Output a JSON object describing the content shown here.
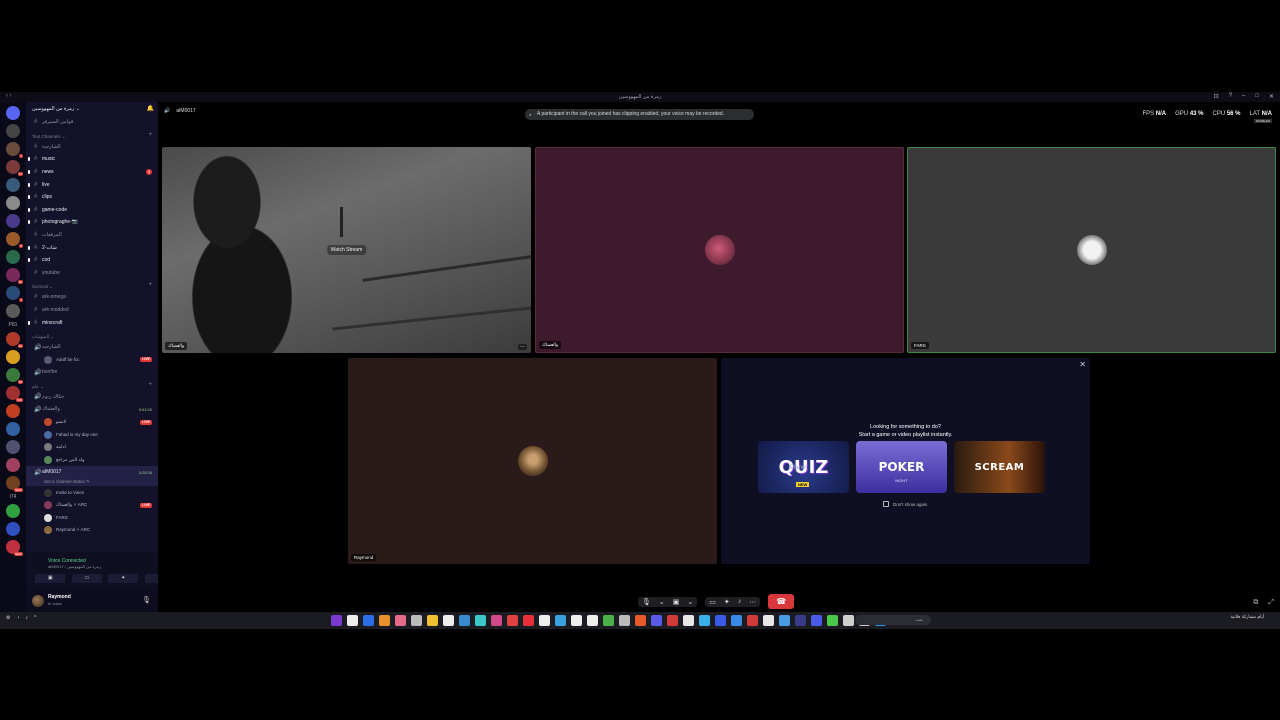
{
  "titlebar": {
    "title": "زمرة من المهووسين"
  },
  "rail": {
    "count_label": "P81",
    "count_label_2": "I74",
    "servers": [
      {
        "color": "#5865f2",
        "badge": ""
      },
      {
        "color": "#444",
        "badge": ""
      },
      {
        "color": "#6a4a3a",
        "badge": "3"
      },
      {
        "color": "#7a3a3a",
        "badge": "27"
      },
      {
        "color": "#3a5a7a",
        "badge": ""
      },
      {
        "color": "#8a8a8a",
        "badge": ""
      },
      {
        "color": "#4a3a8a",
        "badge": ""
      },
      {
        "color": "#9a5a2a",
        "badge": "5"
      },
      {
        "color": "#2a6a4a",
        "badge": ""
      },
      {
        "color": "#7a2a5a",
        "badge": "99"
      },
      {
        "color": "#2a4a7a",
        "badge": "3"
      },
      {
        "color": "#5a5a5a",
        "badge": ""
      }
    ],
    "servers_2": [
      {
        "color": "#b03a2a",
        "badge": "34"
      },
      {
        "color": "#d9a020",
        "badge": ""
      },
      {
        "color": "#3a7a3a",
        "badge": "99"
      },
      {
        "color": "#a03030",
        "badge": "100"
      },
      {
        "color": "#c04020",
        "badge": ""
      },
      {
        "color": "#3060a0",
        "badge": ""
      },
      {
        "color": "#505070",
        "badge": ""
      },
      {
        "color": "#a04060",
        "badge": ""
      },
      {
        "color": "#704020",
        "badge": "NEW"
      }
    ],
    "servers_3": [
      {
        "color": "#30a040",
        "badge": ""
      },
      {
        "color": "#3050c0",
        "badge": ""
      },
      {
        "color": "#c03040",
        "badge": "NEW"
      }
    ]
  },
  "sidebar": {
    "server_name": "زمرة من المهووسين",
    "top_channel": "قوانين السيرفر",
    "text_category": "Text Channels",
    "text_channels": [
      {
        "name": "الشارجية",
        "bright": false,
        "count": ""
      },
      {
        "name": "music",
        "bright": true,
        "count": ""
      },
      {
        "name": "news",
        "bright": true,
        "count": "3"
      },
      {
        "name": "live",
        "bright": true,
        "count": ""
      },
      {
        "name": "clips",
        "bright": true,
        "count": ""
      },
      {
        "name": "game-code",
        "bright": true,
        "count": ""
      },
      {
        "name": "photograghe-📷",
        "bright": true,
        "count": ""
      },
      {
        "name": "المرفقات",
        "bright": false,
        "count": ""
      },
      {
        "name": "شات-2",
        "bright": true,
        "count": ""
      },
      {
        "name": "cod",
        "bright": true,
        "count": ""
      },
      {
        "name": "youtube",
        "bright": false,
        "count": ""
      }
    ],
    "survival_category": "Survival",
    "survival_channels": [
      {
        "name": "ark-omega",
        "bright": false
      },
      {
        "name": "ark-modded",
        "bright": false
      },
      {
        "name": "minecraft",
        "bright": true
      }
    ],
    "voice_category": "الصوتيات",
    "voice_channel_1": "الشارجيه",
    "voice_1_user": "Adolf be fcc",
    "voice_1_live": "LIVE",
    "bonfire": "bonfire",
    "cat3": "عام",
    "voice_channel_2": "حكاك ريوم",
    "voice_channel_3": "والعشاك",
    "voice_3_timer": "9:01:00",
    "voice_3_users": [
      {
        "name": "لانسو",
        "live": "LIVE",
        "color": "#c04a2a"
      },
      {
        "name": "Fahad is my day one",
        "live": "",
        "color": "#4a6aa0"
      },
      {
        "name": "ادليته",
        "live": "",
        "color": "#7a7a7a"
      },
      {
        "name": "ولد المن مراجع",
        "live": "",
        "color": "#5a8a5a"
      }
    ],
    "active_channel": "aIM0017",
    "active_timer": "3:25:34",
    "active_status": "Set a channel status ✎",
    "invite": "Invite to Voice",
    "active_users": [
      {
        "name": "والعشاك ⚡ ARC",
        "live": "LIVE",
        "color": "#8a3a5a"
      },
      {
        "name": "FARS",
        "live": "",
        "color": "#dddddd"
      },
      {
        "name": "Raymond ⚡ ARC",
        "live": "",
        "color": "#8a6a3a"
      }
    ]
  },
  "voice": {
    "status": "Voice Connected",
    "channel": "aIM0017 / زمرة من المهووسين"
  },
  "user": {
    "name": "Raymond",
    "status": "In voice"
  },
  "stage": {
    "channel": "aIM0017",
    "notice": "A participant in the call you joined has clipping enabled, your voice may be recorded.",
    "perf": {
      "fps_label": "FPS",
      "fps": "N/A",
      "gpu_label": "GPU",
      "gpu": "43 %",
      "cpu_label": "CPU",
      "cpu": "56 %",
      "lat_label": "LAT",
      "lat": "N/A",
      "enabled": "ENABLED"
    },
    "tiles": [
      {
        "label": "والعشاك",
        "watch": "Watch Stream",
        "bg": "stream"
      },
      {
        "label": "والعشاك",
        "bg": "#3d1a2c",
        "avatar": "#8a2a4a"
      },
      {
        "label": "FARS",
        "bg": "#3a3a3a",
        "avatar": "#dddddd"
      },
      {
        "label": "Raymond",
        "bg": "#2a1a1a",
        "avatar": "#7a5a3a"
      }
    ]
  },
  "activity": {
    "title_1": "Looking for something to do?",
    "title_2": "Start a game or video playlist instantly.",
    "cards": [
      {
        "title": "QUIZ",
        "sub": "Planet",
        "tag": "NEW"
      },
      {
        "title": "POKER",
        "sub": "NIGHT"
      },
      {
        "title": "SCREAM"
      }
    ],
    "dont_show": "Don't show again"
  },
  "taskbar": {
    "time": "أيام مشاركة فلاتية",
    "search_placeholder": "بحث",
    "app_colors": [
      "#7a3ad0",
      "#eee",
      "#2b6ee8",
      "#e8902a",
      "#e86a8a",
      "#bbb",
      "#f0c030",
      "#eee",
      "#3a8ad0",
      "#3ac8c8",
      "#d04a8a",
      "#e04040",
      "#e8303a",
      "#eee",
      "#3aa0e0",
      "#eee",
      "#eee",
      "#4ab04a",
      "#bbb",
      "#e85a2a",
      "#5a5ae8",
      "#d03a3a",
      "#e8e8e8",
      "#3ab0e8",
      "#3a5ae8",
      "#3a8ae8",
      "#d03a3a",
      "#e8e8e8",
      "#4a9ae8",
      "#3a3a8a",
      "#4a5ae8",
      "#4ac84a",
      "#d0d0d0",
      "#c8c8c8",
      "#2a9ae8"
    ]
  }
}
